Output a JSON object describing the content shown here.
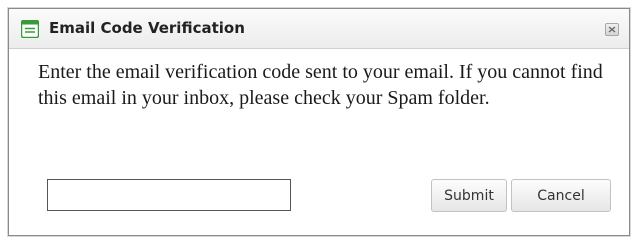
{
  "dialog": {
    "title": "Email Code Verification",
    "title_icon": "form-window-icon",
    "close_icon": "close-icon",
    "message": "Enter the email verification code sent to your email. If you cannot find this email in your inbox, please check your Spam folder.",
    "code_input": {
      "value": "",
      "placeholder": ""
    },
    "buttons": {
      "submit_label": "Submit",
      "cancel_label": "Cancel"
    }
  },
  "colors": {
    "icon_green": "#3a9a3a",
    "border": "#8a8a8a"
  }
}
